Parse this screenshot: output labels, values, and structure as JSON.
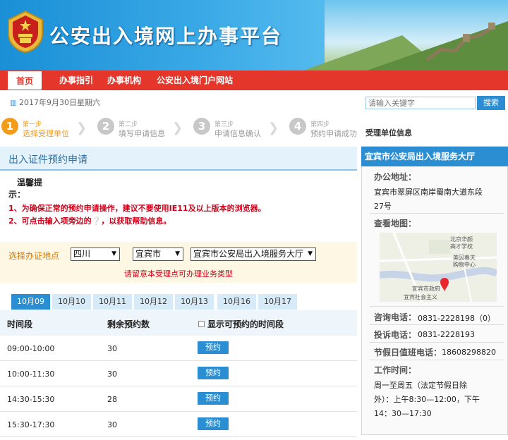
{
  "header": {
    "title": "公安出入境网上办事平台"
  },
  "nav": {
    "items": [
      {
        "label": "首页",
        "active": true
      },
      {
        "label": "办事指引"
      },
      {
        "label": "办事机构"
      },
      {
        "label": "公安出入境门户网站"
      }
    ]
  },
  "date_text": "2017年9月30日星期六",
  "search": {
    "placeholder": "请输入关键字",
    "button_label": "搜索"
  },
  "steps": [
    {
      "kicker": "第一步",
      "number": "1",
      "label": "选择受理单位",
      "active": true
    },
    {
      "kicker": "第二步",
      "number": "2",
      "label": "填写申请信息"
    },
    {
      "kicker": "第三步",
      "number": "3",
      "label": "申请信息确认"
    },
    {
      "kicker": "第四步",
      "number": "4",
      "label": "预约申请成功"
    }
  ],
  "main": {
    "title": "出入证件预约申请",
    "tips_title_1": "温馨提",
    "tips_title_2": "示：",
    "tips": [
      "1、为确保正常的预约申请操作，建议不要使用IE11及以上版本的浏览器。",
      "2、可点击输入项旁边的",
      "，以获取帮助信息。"
    ],
    "location": {
      "label": "选择办证地点",
      "province": "四川",
      "city": "宜宾市",
      "office": "宜宾市公安局出入境服务大厅",
      "note": "请留意本受理点可办理业务类型"
    },
    "date_tabs": [
      "10月09",
      "10月10",
      "10月11",
      "10月12",
      "10月13",
      "10月16",
      "10月17"
    ],
    "table": {
      "headers": [
        "时间段",
        "剩余预约数",
        "显示可预约的时间段"
      ],
      "rows": [
        {
          "time": "09:00-10:00",
          "remaining": "30",
          "action": "预约"
        },
        {
          "time": "10:00-11:30",
          "remaining": "30",
          "action": "预约"
        },
        {
          "time": "14:30-15:30",
          "remaining": "28",
          "action": "预约"
        },
        {
          "time": "15:30-17:30",
          "remaining": "30",
          "action": "预约"
        }
      ]
    }
  },
  "sidebar": {
    "title": "受理单位信息",
    "office_name": "宜宾市公安局出入境服务大厅",
    "address_label": "办公地址：",
    "address_line1": "宜宾市翠屏区南岸蜀南大道东段",
    "address_line2": "27号",
    "map_label": "查看地图：",
    "map_places": [
      "北京华颜",
      "高才学校",
      "美因春天",
      "购物中心",
      "宜宾市政府",
      "宜宾社会主义"
    ],
    "phone_label": "咨询电话：",
    "phone_value": "0831-2228198（0）",
    "complaint_label": "投诉电话：",
    "complaint_value": "0831-2228193",
    "holiday_label": "节假日值班电话：",
    "holiday_value": "18608298820",
    "hours_label": "工作时间：",
    "hours_line1": "周一至周五（法定节假日除",
    "hours_line2": "外）：上午8:30—12:00，下午",
    "hours_line3": "14：30—17:30"
  },
  "colors": {
    "brand_red": "#e4362b",
    "primary_blue": "#2b8ed3",
    "step_orange": "#f39c1b",
    "alert_red": "#d0021b"
  }
}
